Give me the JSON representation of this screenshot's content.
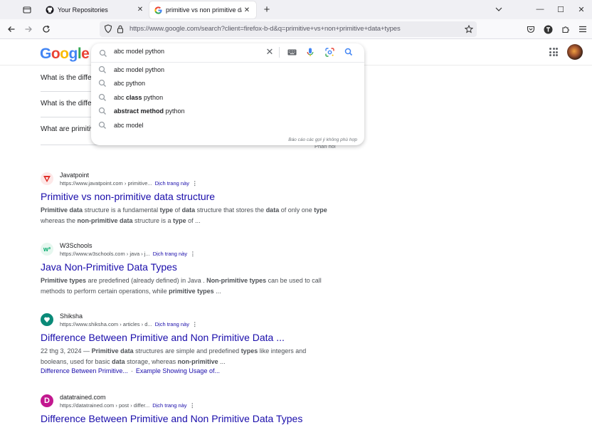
{
  "browser": {
    "tabs": [
      {
        "title": "Your Repositories",
        "icon": "github-icon",
        "active": false
      },
      {
        "title": "primitive vs non primitive data",
        "icon": "google-icon",
        "active": true
      }
    ],
    "url": "https://www.google.com/search?client=firefox-b-d&q=primitive+vs+non+primitive+data+types",
    "url_domain": "google.com"
  },
  "google": {
    "logo": "Google",
    "search_query": "abc model python",
    "suggestions": [
      {
        "parts": [
          {
            "t": "abc model python",
            "b": false
          }
        ]
      },
      {
        "parts": [
          {
            "t": "abc python",
            "b": false
          }
        ]
      },
      {
        "parts": [
          {
            "t": "abc ",
            "b": false
          },
          {
            "t": "class",
            "b": true
          },
          {
            "t": " python",
            "b": false
          }
        ]
      },
      {
        "parts": [
          {
            "t": "abstract method",
            "b": true
          },
          {
            "t": " python",
            "b": false
          }
        ]
      },
      {
        "parts": [
          {
            "t": "abc model",
            "b": false
          }
        ]
      }
    ],
    "report_text": "Báo cáo các gợi ý không phù hợp"
  },
  "related_questions": [
    "What is the difference between primitive and non primitive data types?",
    "What is the difference between primitive and non-primitive data structure?",
    "What are primitive and non primitive data types in Java?"
  ],
  "feedback": "Phản hồi",
  "results": [
    {
      "site": "Javatpoint",
      "url": "https://www.javatpoint.com › primitive...",
      "translate": "Dịch trang này",
      "title": "Primitive vs non-primitive data structure",
      "logo_color": "#e0302a",
      "snippet": [
        {
          "t": "Primitive data",
          "b": true
        },
        {
          "t": " structure is a fundamental ",
          "b": false
        },
        {
          "t": "type",
          "b": true
        },
        {
          "t": " of ",
          "b": false
        },
        {
          "t": "data",
          "b": true
        },
        {
          "t": " structure that stores the ",
          "b": false
        },
        {
          "t": "data",
          "b": true
        },
        {
          "t": " of only one ",
          "b": false
        },
        {
          "t": "type",
          "b": true
        },
        {
          "t": " whereas the ",
          "b": false
        },
        {
          "t": "non-primitive data",
          "b": true
        },
        {
          "t": " structure is a ",
          "b": false
        },
        {
          "t": "type",
          "b": true
        },
        {
          "t": " of ...",
          "b": false
        }
      ],
      "sitelinks": []
    },
    {
      "site": "W3Schools",
      "url": "https://www.w3schools.com › java › j...",
      "translate": "Dịch trang này",
      "title": "Java Non-Primitive Data Types",
      "logo_color": "#04aa6d",
      "snippet": [
        {
          "t": "Primitive types",
          "b": true
        },
        {
          "t": " are predefined (already defined) in Java . ",
          "b": false
        },
        {
          "t": "Non-primitive types",
          "b": true
        },
        {
          "t": " can be used to call methods to perform certain operations, while ",
          "b": false
        },
        {
          "t": "primitive types",
          "b": true
        },
        {
          "t": " ...",
          "b": false
        }
      ],
      "sitelinks": []
    },
    {
      "site": "Shiksha",
      "url": "https://www.shiksha.com › articles › d...",
      "translate": "Dịch trang này",
      "title": "Difference Between Primitive and Non Primitive Data ...",
      "logo_color": "#0a8a78",
      "snippet": [
        {
          "t": "22 thg 3, 2024 — ",
          "b": false
        },
        {
          "t": "Primitive data",
          "b": true
        },
        {
          "t": " structures are simple and predefined ",
          "b": false
        },
        {
          "t": "types",
          "b": true
        },
        {
          "t": " like integers and booleans, used for basic ",
          "b": false
        },
        {
          "t": "data",
          "b": true
        },
        {
          "t": " storage, whereas ",
          "b": false
        },
        {
          "t": "non-primitive",
          "b": true
        },
        {
          "t": " ...",
          "b": false
        }
      ],
      "sitelinks": [
        "Difference Between Primitive...",
        "·",
        "Example Showing Usage of..."
      ]
    },
    {
      "site": "datatrained.com",
      "url": "https://datatrained.com › post › differ...",
      "translate": "Dịch trang này",
      "title": "Difference Between Primitive and Non Primitive Data Types",
      "logo_color": "#c2188f",
      "snippet": [],
      "sitelinks": []
    }
  ]
}
